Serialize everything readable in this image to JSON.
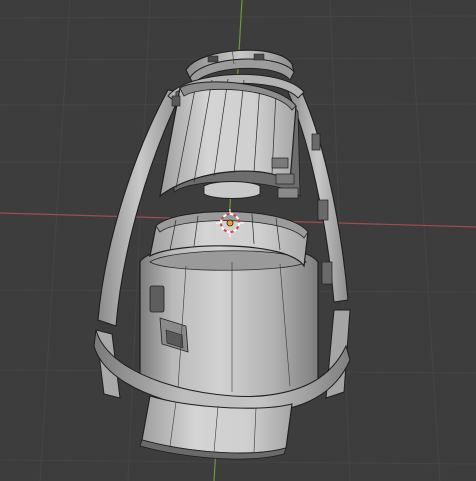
{
  "viewport": {
    "background": "#3d3d3d",
    "grid_color": "#454545",
    "x_axis_color": "#a14a55",
    "y_axis_color": "#6f9a2e"
  },
  "model": {
    "fill_light": "#cfcfcf",
    "fill_mid": "#a9a9a9",
    "fill_dark": "#7a7a7a",
    "edge": "#1f1f1f"
  },
  "cursor": {
    "icon": "3d-cursor-icon",
    "ring_color_a": "#ffffff",
    "ring_color_b": "#e03b3b",
    "origin_color": "#f0a21a"
  }
}
